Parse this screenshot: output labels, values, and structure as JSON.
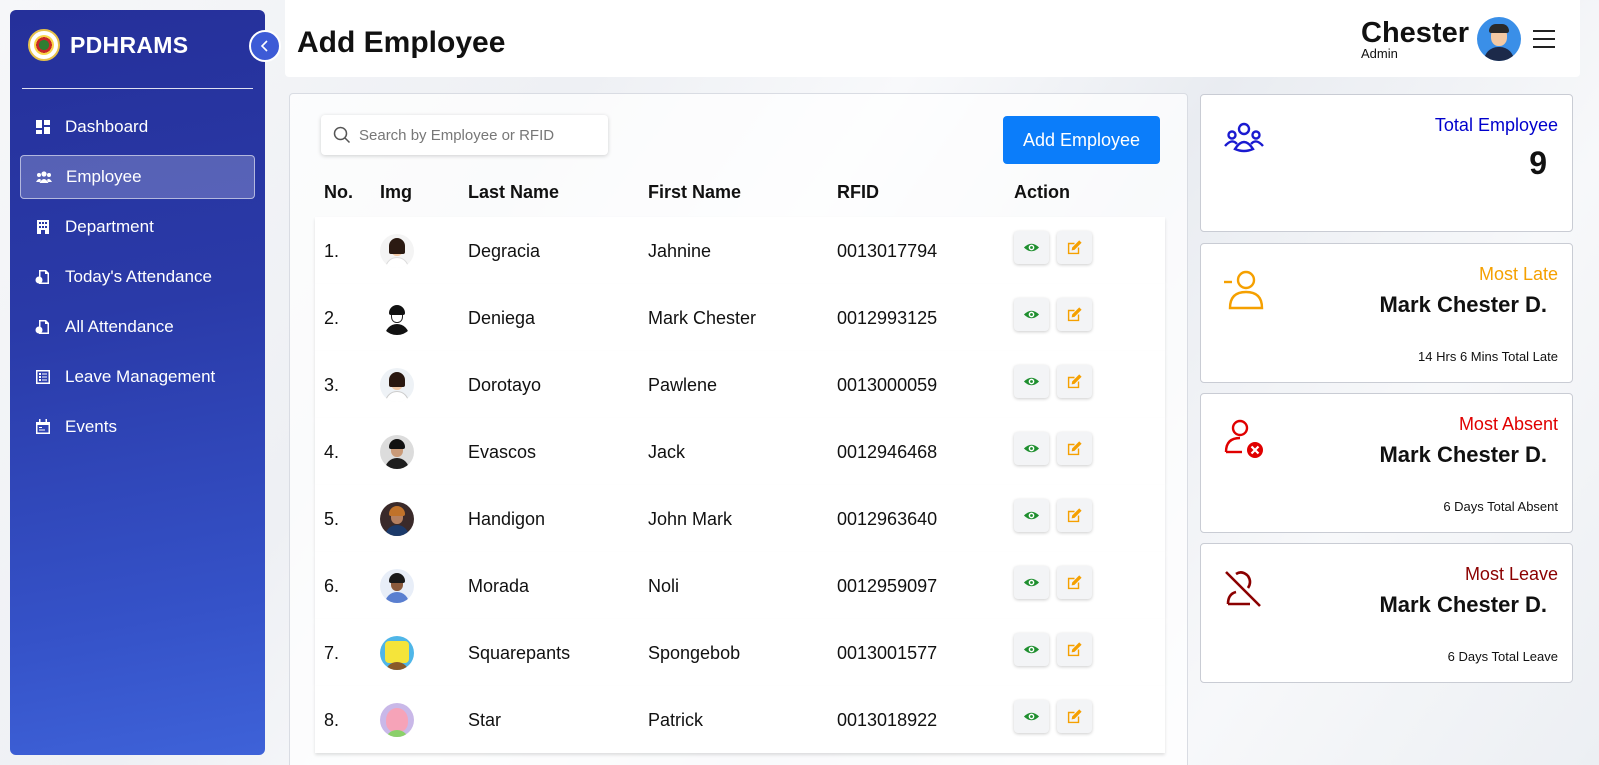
{
  "app": {
    "name": "PDHRAMS"
  },
  "sidebar": {
    "items": [
      {
        "label": "Dashboard",
        "icon": "dashboard-icon"
      },
      {
        "label": "Employee",
        "icon": "users-icon",
        "active": true
      },
      {
        "label": "Department",
        "icon": "building-icon"
      },
      {
        "label": "Today's Attendance",
        "icon": "attendance-icon"
      },
      {
        "label": "All Attendance",
        "icon": "attendance-icon"
      },
      {
        "label": "Leave Management",
        "icon": "list-icon"
      },
      {
        "label": "Events",
        "icon": "calendar-icon"
      }
    ]
  },
  "header": {
    "title": "Add Employee",
    "user_name": "Chester",
    "user_role": "Admin"
  },
  "search": {
    "placeholder": "Search by Employee or RFID"
  },
  "toolbar": {
    "add_label": "Add Employee"
  },
  "table": {
    "columns": [
      "No.",
      "Img",
      "Last Name",
      "First Name",
      "RFID",
      "Action"
    ],
    "rows": [
      {
        "no": "1.",
        "last": "Degracia",
        "first": "Jahnine",
        "rfid": "0013017794"
      },
      {
        "no": "2.",
        "last": "Deniega",
        "first": "Mark Chester",
        "rfid": "0012993125"
      },
      {
        "no": "3.",
        "last": "Dorotayo",
        "first": "Pawlene",
        "rfid": "0013000059"
      },
      {
        "no": "4.",
        "last": "Evascos",
        "first": "Jack",
        "rfid": "0012946468"
      },
      {
        "no": "5.",
        "last": "Handigon",
        "first": "John Mark",
        "rfid": "0012963640"
      },
      {
        "no": "6.",
        "last": "Morada",
        "first": "Noli",
        "rfid": "0012959097"
      },
      {
        "no": "7.",
        "last": "Squarepants",
        "first": "Spongebob",
        "rfid": "0013001577"
      },
      {
        "no": "8.",
        "last": "Star",
        "first": "Patrick",
        "rfid": "0013018922"
      }
    ]
  },
  "stats": {
    "total": {
      "label": "Total Employee",
      "value": "9",
      "color": "#0000cc"
    },
    "late": {
      "label": "Most Late",
      "name": "Mark Chester D.",
      "detail": "14 Hrs 6 Mins Total Late",
      "color": "#f5a000"
    },
    "absent": {
      "label": "Most Absent",
      "name": "Mark Chester D.",
      "detail": "6 Days Total Absent",
      "color": "#e00000"
    },
    "leave": {
      "label": "Most Leave",
      "name": "Mark Chester D.",
      "detail": "6 Days Total Leave",
      "color": "#8b0000"
    }
  },
  "colors": {
    "view_icon": "#1f8f2f",
    "edit_icon": "#f5a000",
    "accent": "#0b7dfa"
  }
}
